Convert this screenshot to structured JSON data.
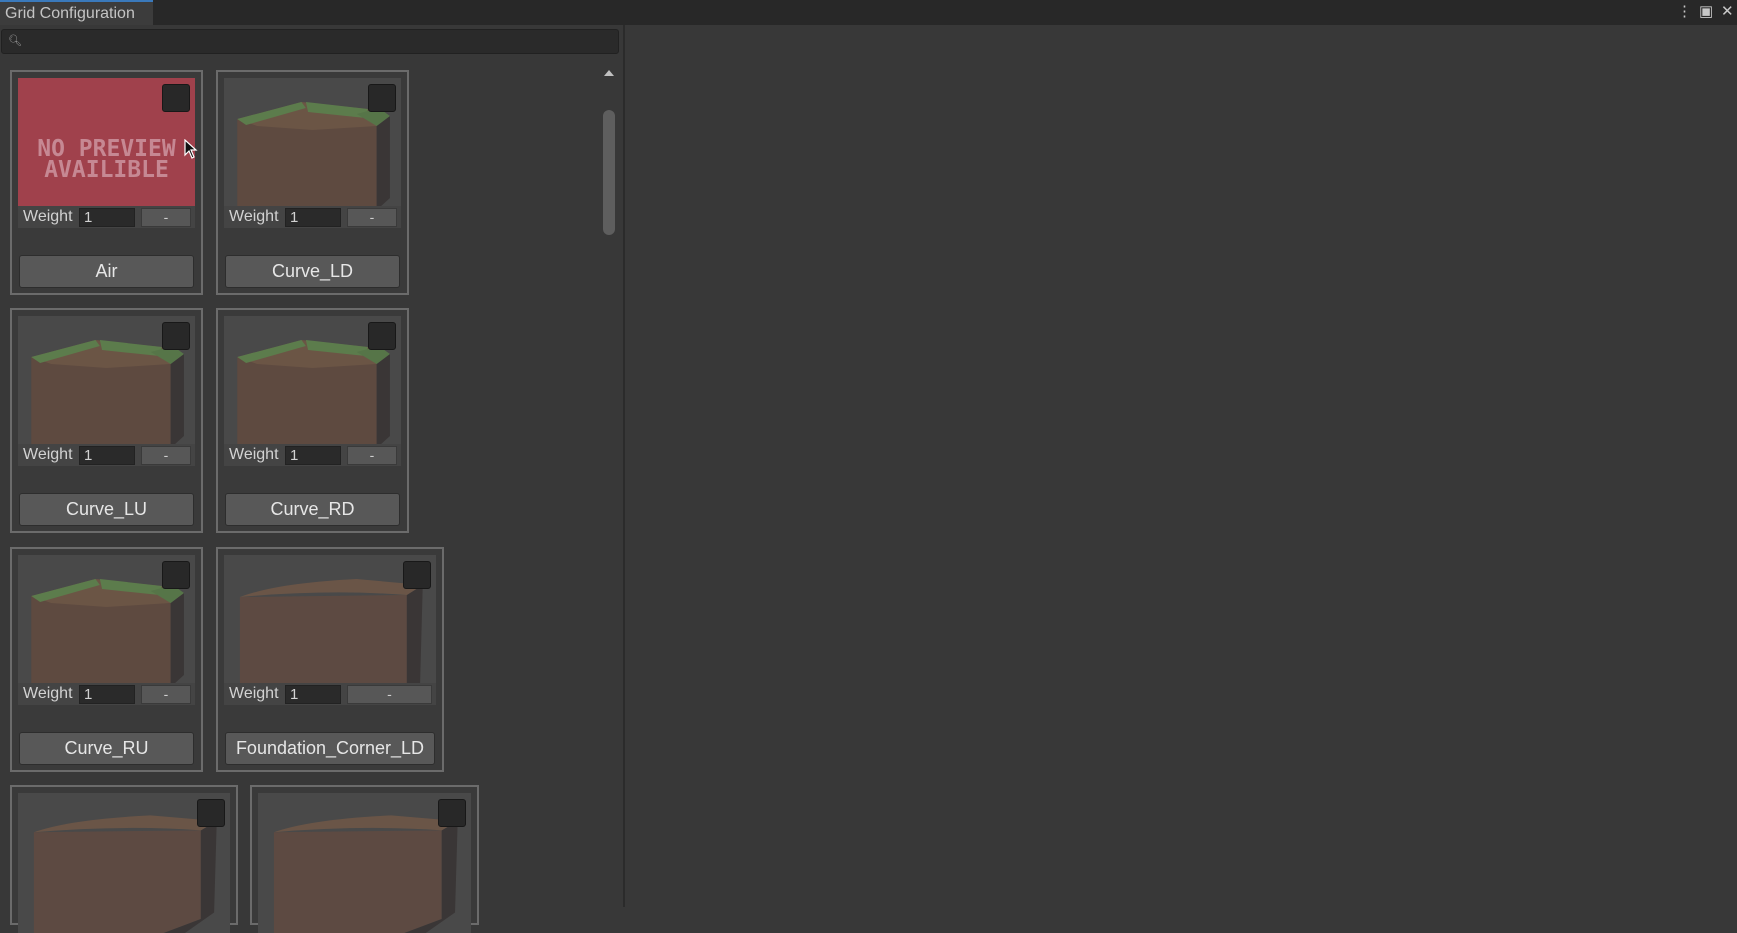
{
  "window": {
    "tab_title": "Grid Configuration",
    "controls": [
      "more-icon",
      "maximize-icon",
      "close-icon"
    ]
  },
  "search": {
    "value": "",
    "placeholder": ""
  },
  "tiles": [
    {
      "name": "Air",
      "weight_label": "Weight",
      "weight_value": "1",
      "remove_label": "-",
      "preview": "no-preview",
      "preview_text": [
        "NO PREVIEW",
        "AVAILIBLE"
      ],
      "selected": false
    },
    {
      "name": "Curve_LD",
      "weight_label": "Weight",
      "weight_value": "1",
      "remove_label": "-",
      "preview": "curve-block",
      "selected": false
    },
    {
      "name": "Curve_LU",
      "weight_label": "Weight",
      "weight_value": "1",
      "remove_label": "-",
      "preview": "curve-block",
      "selected": false
    },
    {
      "name": "Curve_RD",
      "weight_label": "Weight",
      "weight_value": "1",
      "remove_label": "-",
      "preview": "curve-block",
      "selected": false
    },
    {
      "name": "Curve_RU",
      "weight_label": "Weight",
      "weight_value": "1",
      "remove_label": "-",
      "preview": "curve-block",
      "selected": false
    },
    {
      "name": "Foundation_Corner_LD",
      "weight_label": "Weight",
      "weight_value": "1",
      "remove_label": "-",
      "preview": "foundation-block",
      "selected": false
    },
    {
      "preview": "foundation-block",
      "selected": false
    },
    {
      "preview": "foundation-block",
      "selected": false
    }
  ],
  "colors": {
    "background": "#383838",
    "titlebar": "#282828",
    "tab_accent": "#3a79bb",
    "no_preview": "#a0414c",
    "button": "#585858",
    "block_top_grass": "#5c7c4c",
    "block_side": "#5e4a40"
  }
}
